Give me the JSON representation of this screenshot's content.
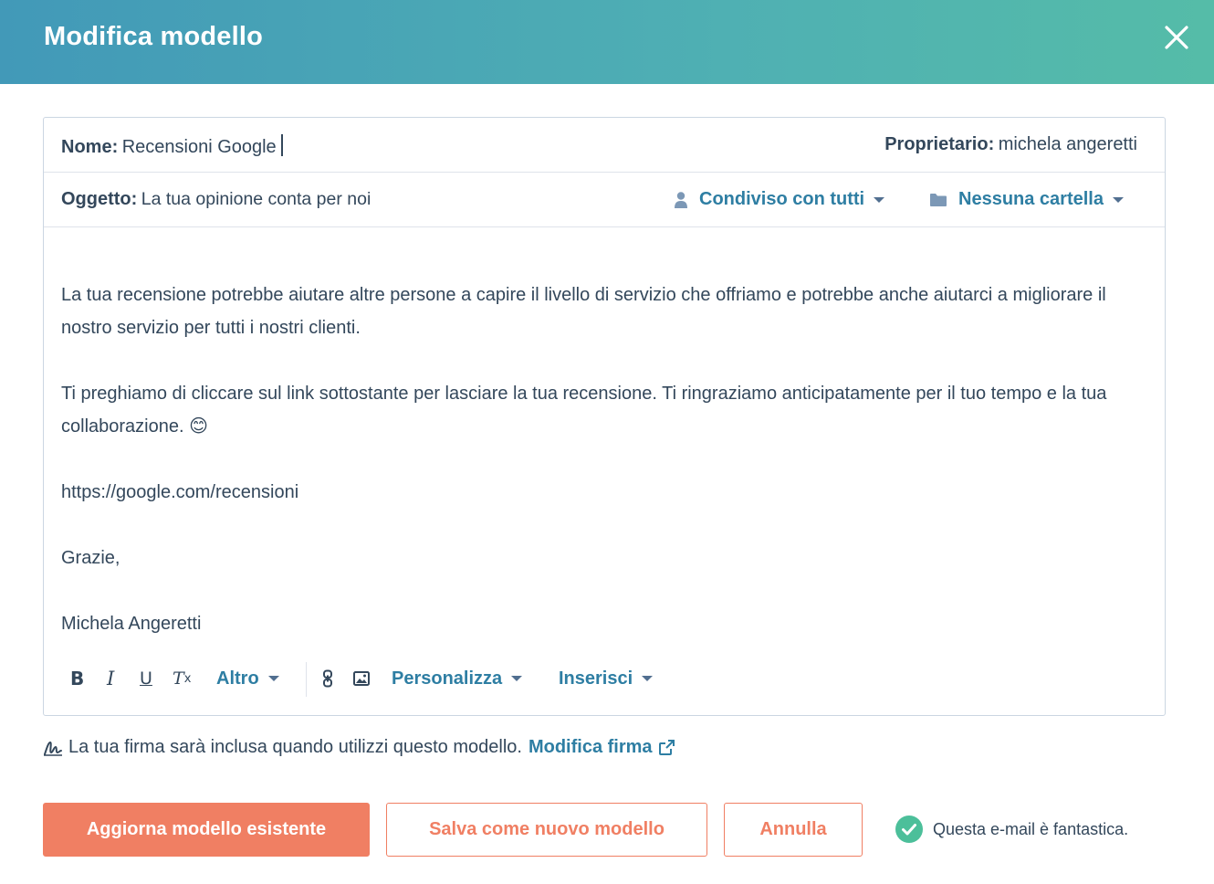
{
  "header": {
    "title": "Modifica modello"
  },
  "fields": {
    "name_label": "Nome:",
    "name_value": "Recensioni Google",
    "owner_label": "Proprietario:",
    "owner_value": "michela angeretti",
    "subject_label": "Oggetto:",
    "subject_value": "La tua opinione conta per noi",
    "sharing_label": "Condiviso con tutti",
    "folder_label": "Nessuna cartella"
  },
  "body": {
    "paragraphs": [
      "La tua recensione potrebbe aiutare altre persone a capire il livello di servizio che offriamo e potrebbe anche aiutarci a migliorare il nostro servizio per tutti i nostri clienti.",
      "Ti preghiamo di cliccare sul link sottostante per lasciare la tua recensione. Ti ringraziamo anticipatamente per il tuo tempo e la tua collaborazione. 😊",
      "https://google.com/recensioni",
      "Grazie,",
      "Michela Angeretti"
    ]
  },
  "toolbar": {
    "bold": "B",
    "italic": "I",
    "underline": "U",
    "clear_format": "T",
    "clear_format_sub": "x",
    "more_label": "Altro",
    "personalize_label": "Personalizza",
    "insert_label": "Inserisci"
  },
  "signature": {
    "note": "La tua firma sarà inclusa quando utilizzi questo modello.",
    "edit_link": "Modifica firma"
  },
  "actions": {
    "update_label": "Aggiorna modello esistente",
    "save_new_label": "Salva come nuovo modello",
    "cancel_label": "Annulla"
  },
  "quality": {
    "message": "Questa e-mail è fantastica."
  },
  "colors": {
    "header_start": "#4299b8",
    "header_end": "#55bca8",
    "accent_link": "#2e7ea3",
    "primary_button": "#f07f63",
    "success": "#4cbf9a"
  }
}
